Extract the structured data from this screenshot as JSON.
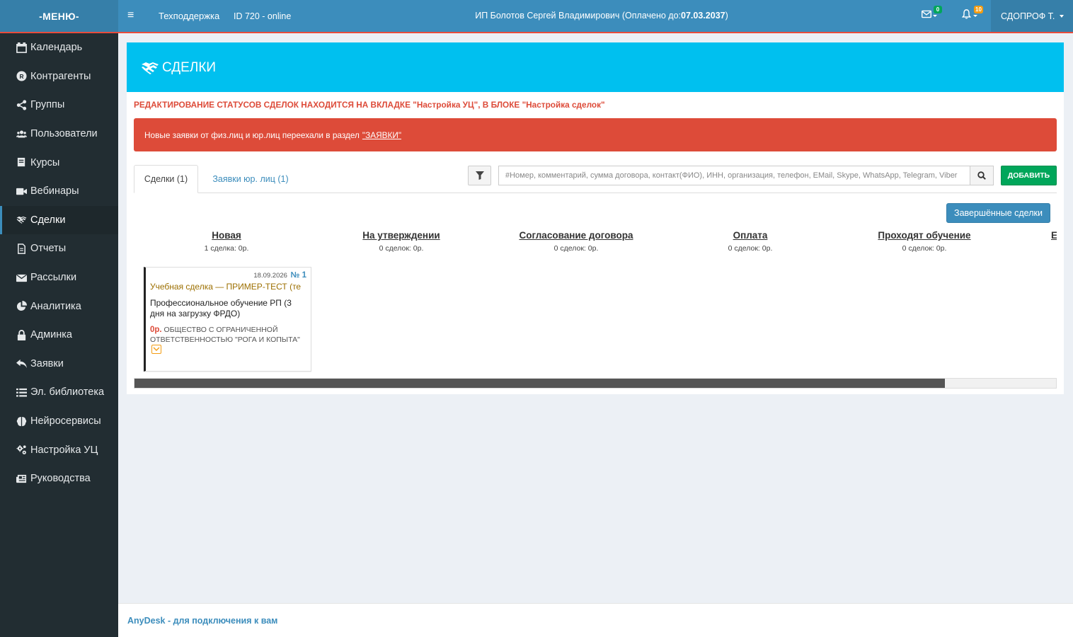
{
  "header": {
    "brand": "-МЕНЮ-",
    "support_link": "Техподдержка",
    "session": "ID 720 - online",
    "owner_text": "ИП Болотов Сергей Владимирович (Оплачено до:",
    "paid_until": "07.03.2037",
    "owner_suffix": ")",
    "mail_count": "0",
    "notify_count": "10",
    "user": "СДОПРОФ Т."
  },
  "sidebar": {
    "items": [
      {
        "label": "Календарь",
        "icon": "calendar-icon"
      },
      {
        "label": "Контрагенты",
        "icon": "registered-icon"
      },
      {
        "label": "Группы",
        "icon": "share-icon"
      },
      {
        "label": "Пользователи",
        "icon": "users-icon"
      },
      {
        "label": "Курсы",
        "icon": "book-icon"
      },
      {
        "label": "Вебинары",
        "icon": "video-icon"
      },
      {
        "label": "Сделки",
        "icon": "handshake-icon",
        "active": true
      },
      {
        "label": "Отчеты",
        "icon": "file-icon"
      },
      {
        "label": "Рассылки",
        "icon": "envelope-icon"
      },
      {
        "label": "Аналитика",
        "icon": "pie-chart-icon"
      },
      {
        "label": "Админка",
        "icon": "lock-icon"
      },
      {
        "label": "Заявки",
        "icon": "reply-icon"
      },
      {
        "label": "Эл. библиотека",
        "icon": "list-icon"
      },
      {
        "label": "Нейросервисы",
        "icon": "brain-icon"
      },
      {
        "label": "Настройка УЦ",
        "icon": "cogs-icon"
      },
      {
        "label": "Руководства",
        "icon": "newspaper-icon"
      }
    ]
  },
  "page": {
    "title": "СДЕЛКИ",
    "warning": "РЕДАКТИРОВАНИЕ СТАТУСОВ СДЕЛОК НАХОДИТСЯ НА ВКЛАДКЕ \"Настройка УЦ\", В БЛОКЕ \"Настройка сделок\"",
    "alert_text": "Новые заявки от физ.лиц и юр.лиц переехали в раздел",
    "alert_link": "\"ЗАЯВКИ\""
  },
  "tabs": [
    {
      "label": "Сделки (1)",
      "active": true
    },
    {
      "label": "Заявки юр. лиц (1)",
      "active": false
    }
  ],
  "search": {
    "placeholder": "#Номер, комментарий, сумма договора, контакт(ФИО), ИНН, организация, телефон, EMail, Skype, WhatsApp, Telegram, Viber",
    "add_label": "ДОБАВИТЬ"
  },
  "completed_button": "Завершённые сделки",
  "columns": [
    {
      "title": "Новая",
      "summary": "1 сделка: 0р."
    },
    {
      "title": "На утверждении",
      "summary": "0 сделок: 0р."
    },
    {
      "title": "Согласование договора",
      "summary": "0 сделок: 0р."
    },
    {
      "title": "Оплата",
      "summary": "0 сделок: 0р."
    },
    {
      "title": "Проходят обучение",
      "summary": "0 сделок: 0р."
    },
    {
      "title": "Е",
      "summary": ""
    }
  ],
  "card": {
    "date": "18.09.2026",
    "number": "№ 1",
    "title": "Учебная сделка — ПРИМЕР-ТЕСТ (те",
    "course": "Профессиональное обучение РП (3 дня на загрузку ФРДО)",
    "sum": "0р.",
    "org": "ОБЩЕСТВО С ОГРАНИЧЕННОЙ ОТВЕТСТВЕННОСТЬЮ \"РОГА И КОПЫТА\""
  },
  "scroll": {
    "position_fraction": 0.88
  },
  "footer": {
    "text": "AnyDesk - для подключения к вам"
  }
}
